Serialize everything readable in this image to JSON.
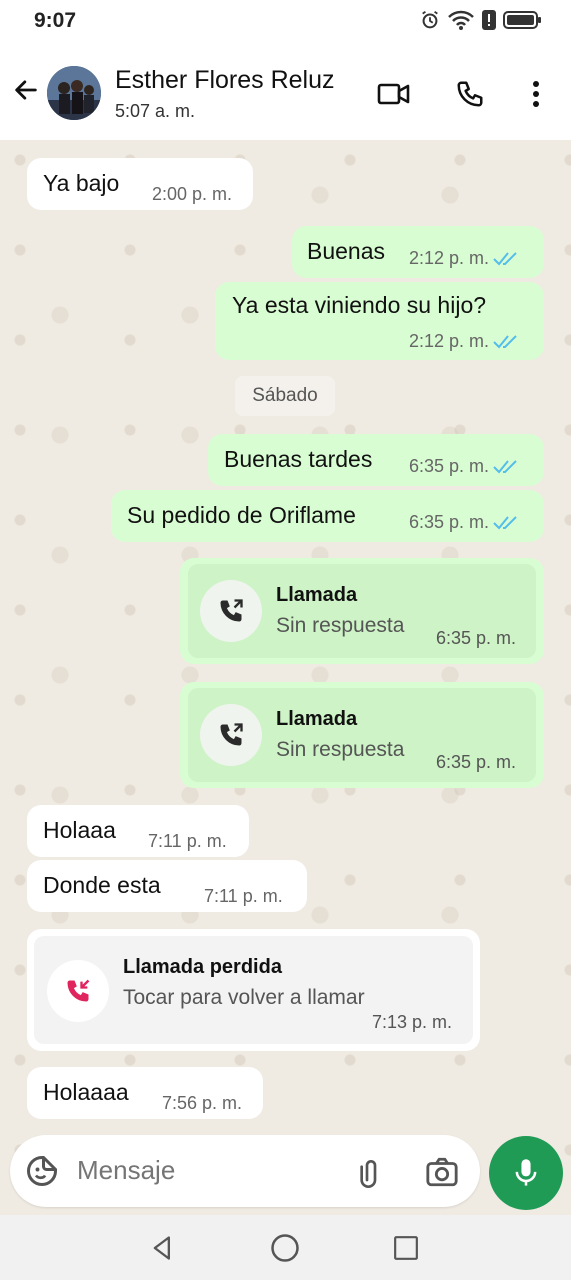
{
  "status": {
    "time": "9:07"
  },
  "header": {
    "contact_name": "Esther Flores Reluz",
    "last_seen": "5:07 a. m."
  },
  "messages": [
    {
      "dir": "in",
      "text": "Ya bajo",
      "time": "2:00 p. m."
    },
    {
      "dir": "out",
      "text": "Buenas",
      "time": "2:12 p. m."
    },
    {
      "dir": "out",
      "text": "Ya esta viniendo su hijo?",
      "time": "2:12 p. m."
    },
    {
      "dir": "out",
      "text": "Buenas tardes",
      "time": "6:35 p. m."
    },
    {
      "dir": "out",
      "text": "Su pedido de Oriflame",
      "time": "6:35 p. m."
    },
    {
      "dir": "in",
      "text": "Holaaa",
      "time": "7:11 p. m."
    },
    {
      "dir": "in",
      "text": "Donde esta",
      "time": "7:11 p. m."
    },
    {
      "dir": "in",
      "text": "Holaaaa",
      "time": "7:56 p. m."
    }
  ],
  "date_separator": "Sábado",
  "calls": [
    {
      "title": "Llamada",
      "subtitle": "Sin respuesta",
      "time": "6:35 p. m."
    },
    {
      "title": "Llamada",
      "subtitle": "Sin respuesta",
      "time": "6:35 p. m."
    }
  ],
  "missed_call": {
    "title": "Llamada perdida",
    "subtitle": "Tocar para volver a llamar",
    "time": "7:13 p. m."
  },
  "input": {
    "placeholder": "Mensaje"
  },
  "colors": {
    "accent": "#1f9b55",
    "outgoing_bubble": "#d9fdd3",
    "chat_bg": "#efeae2",
    "read_ticks": "#53bdeb",
    "missed_call": "#e0245e"
  }
}
